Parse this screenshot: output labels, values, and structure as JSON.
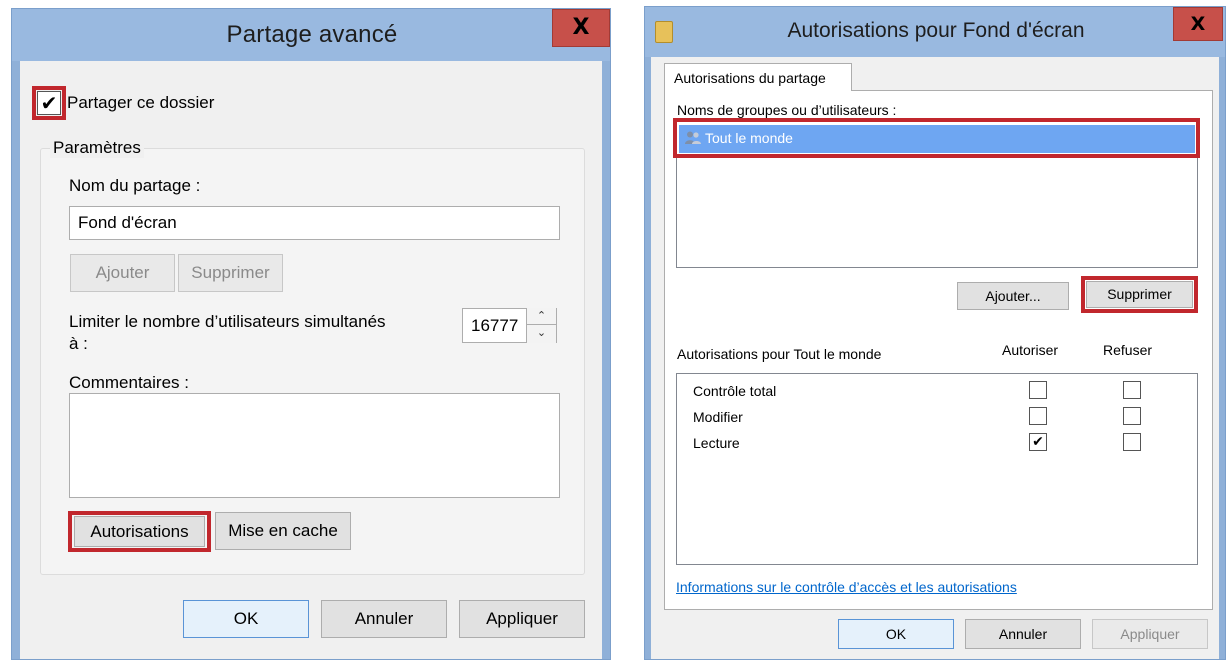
{
  "left_dialog": {
    "title": "Partage avancé",
    "close_label": "X",
    "share_checkbox": {
      "label": "Partager ce dossier",
      "checked": true,
      "mark": "✔"
    },
    "settings_group_title": "Paramètres",
    "share_name_label": "Nom du partage :",
    "share_name_value": "Fond d'écran",
    "add_button": "Ajouter",
    "remove_button": "Supprimer",
    "limit_label_line1": "Limiter le nombre d’utilisateurs simultanés",
    "limit_label_line2": "à :",
    "limit_value": "16777",
    "spin_up": "⌃",
    "spin_down": "⌄",
    "comments_label": "Commentaires :",
    "comments_value": "",
    "permissions_button": "Autorisations",
    "cache_button": "Mise en cache",
    "ok_button": "OK",
    "cancel_button": "Annuler",
    "apply_button": "Appliquer"
  },
  "right_dialog": {
    "title": "Autorisations pour Fond d'écran",
    "close_label": "X",
    "tab_label": "Autorisations du partage",
    "groups_label": "Noms de groupes ou d’utilisateurs :",
    "groups": [
      {
        "name": "Tout le monde",
        "selected": true
      }
    ],
    "add_button": "Ajouter...",
    "remove_button": "Supprimer",
    "permissions_for_label": "Autorisations pour Tout le monde",
    "allow_header": "Autoriser",
    "deny_header": "Refuser",
    "permissions": [
      {
        "name": "Contrôle total",
        "allow": false,
        "deny": false
      },
      {
        "name": "Modifier",
        "allow": false,
        "deny": false
      },
      {
        "name": "Lecture",
        "allow": true,
        "deny": false
      }
    ],
    "check_mark": "✔",
    "info_link": "Informations sur le contrôle d’accès et les autorisations",
    "ok_button": "OK",
    "cancel_button": "Annuler",
    "apply_button": "Appliquer"
  },
  "colors": {
    "highlight": "#c1272d",
    "title_bar": "#99b9e0",
    "selection": "#6ea6f2",
    "close_button": "#c7504a"
  }
}
